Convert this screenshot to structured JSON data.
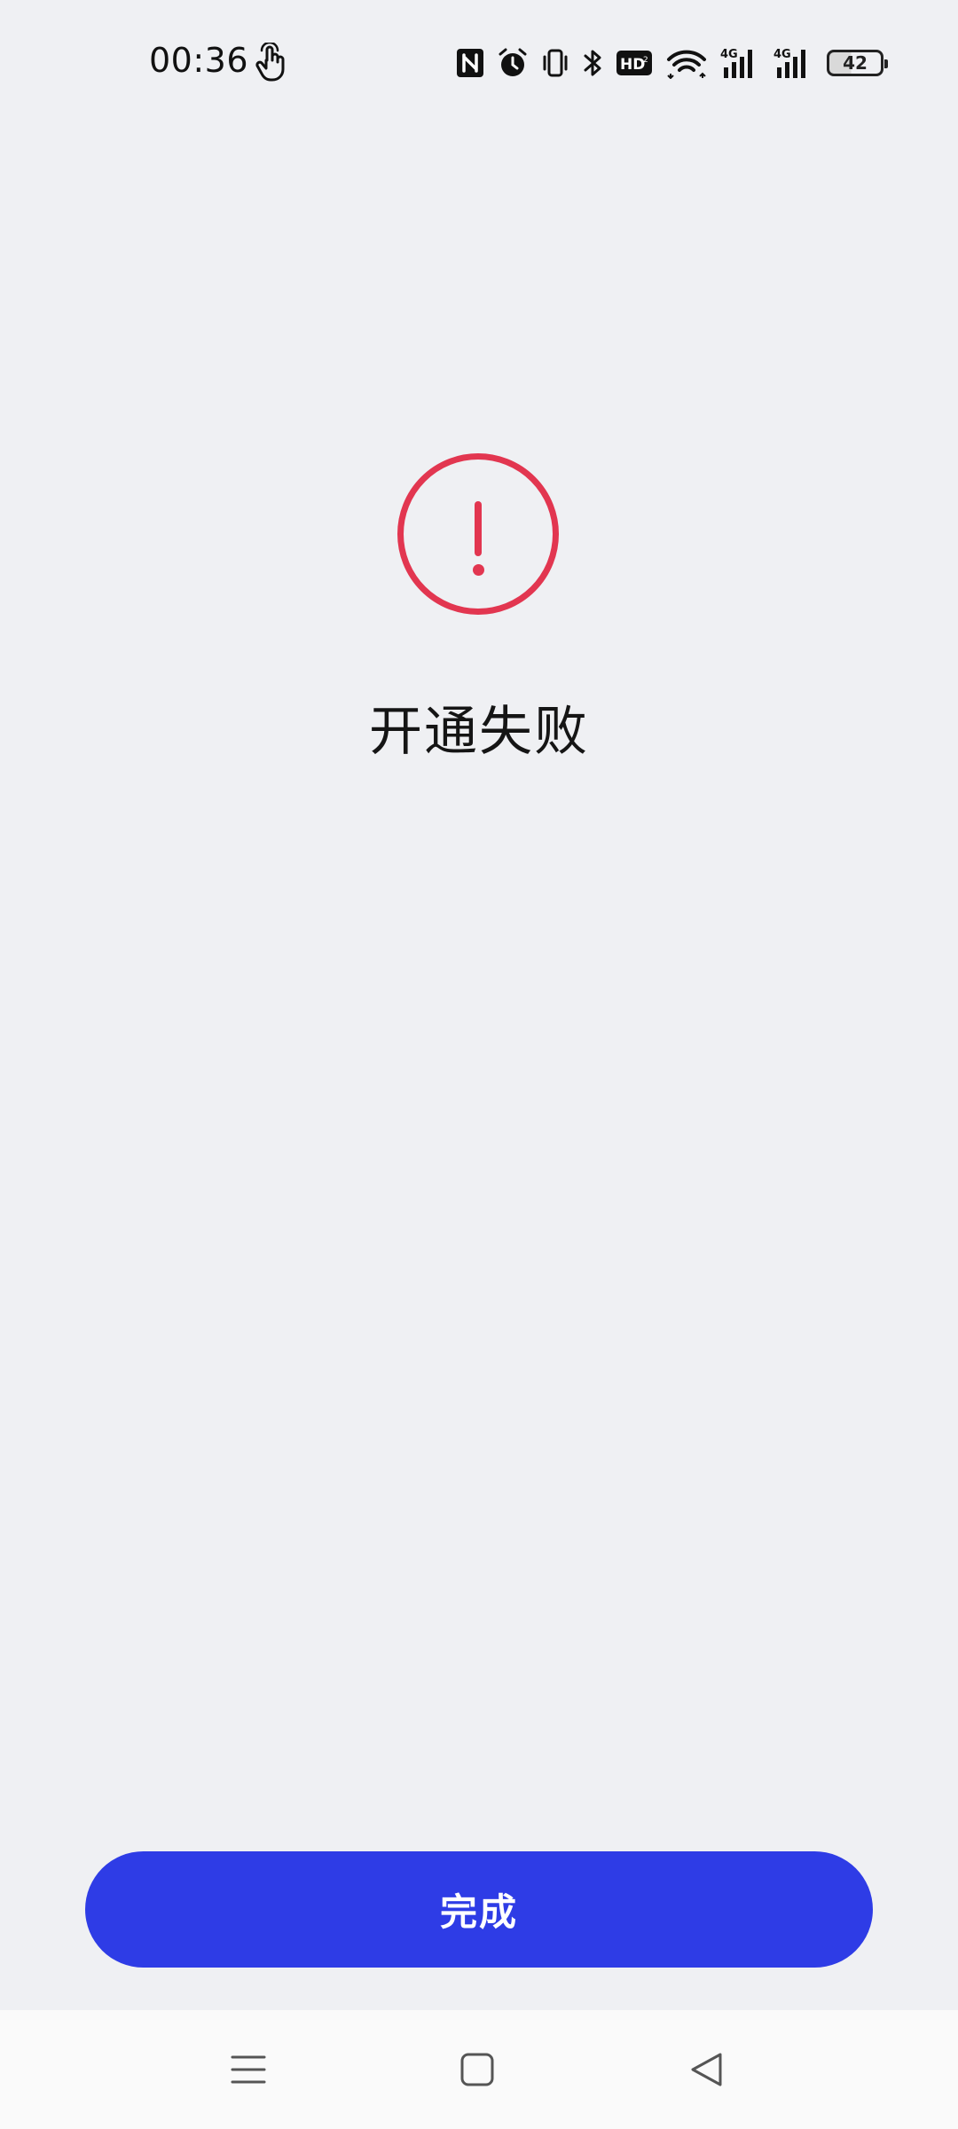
{
  "status_bar": {
    "time": "00:36",
    "battery": "42",
    "icons": [
      "touch-gesture-icon",
      "nfc-icon",
      "alarm-icon",
      "vibrate-icon",
      "bluetooth-icon",
      "hd-voice-icon",
      "wifi-icon",
      "signal-4g-icon",
      "signal-4g-icon",
      "battery-icon"
    ]
  },
  "result": {
    "icon": "exclamation-circle-icon",
    "title": "开通失败"
  },
  "done_button": {
    "label": "完成"
  },
  "nav_bar": {
    "items": [
      "menu-icon",
      "home-icon",
      "back-icon"
    ]
  },
  "colors": {
    "background": "#eff0f3",
    "error_red": "#e23650",
    "primary_button": "#2e3ce6",
    "nav_background": "#fafafa"
  }
}
